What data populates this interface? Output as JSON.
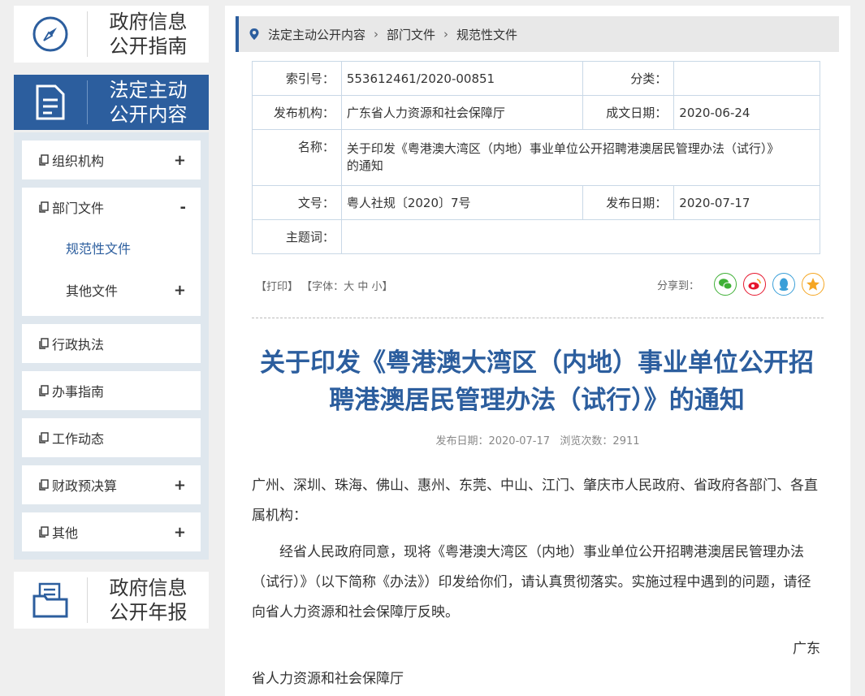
{
  "sidebar": {
    "guide": {
      "line1": "政府信息",
      "line2": "公开指南",
      "icon": "compass-icon"
    },
    "active": {
      "line1": "法定主动",
      "line2": "公开内容",
      "icon": "document-icon"
    },
    "items": [
      {
        "label": "组织机构",
        "toggle": "+"
      },
      {
        "label": "部门文件",
        "toggle": "-"
      },
      {
        "label": "行政执法",
        "toggle": ""
      },
      {
        "label": "办事指南",
        "toggle": ""
      },
      {
        "label": "工作动态",
        "toggle": ""
      },
      {
        "label": "财政预决算",
        "toggle": "+"
      },
      {
        "label": "其他",
        "toggle": "+"
      }
    ],
    "sub_items": [
      {
        "label": "规范性文件",
        "toggle": ""
      },
      {
        "label": "其他文件",
        "toggle": "+"
      }
    ],
    "annual": {
      "line1": "政府信息",
      "line2": "公开年报",
      "icon": "folder-icon"
    }
  },
  "breadcrumb": [
    "法定主动公开内容",
    "部门文件",
    "规范性文件"
  ],
  "meta": {
    "index_label": "索引号：",
    "index_value": "553612461/2020-00851",
    "category_label": "分类：",
    "category_value": "",
    "issuer_label": "发布机构：",
    "issuer_value": "广东省人力资源和社会保障厅",
    "created_label": "成文日期：",
    "created_value": "2020-06-24",
    "name_label": "名称：",
    "name_value": "关于印发《粤港澳大湾区（内地）事业单位公开招聘港澳居民管理办法（试行）》的通知",
    "docno_label": "文号：",
    "docno_value": "粤人社规〔2020〕7号",
    "pubdate_label": "发布日期：",
    "pubdate_value": "2020-07-17",
    "subject_label": "主题词：",
    "subject_value": ""
  },
  "tools": {
    "print": "【打印】",
    "font_prefix": "【字体：",
    "font_large": "大",
    "font_medium": "中",
    "font_small": "小",
    "font_suffix": "】",
    "share_label": "分享到："
  },
  "colors": {
    "accent": "#2c5e9e",
    "wechat": "#3fb036",
    "weibo": "#e6162d",
    "qq": "#3a9fd8",
    "qzone": "#f5a623"
  },
  "article": {
    "title_line1": "关于印发《粤港澳大湾区（内地）事业单位公开招",
    "title_line2": "聘港澳居民管理办法（试行）》的通知",
    "pub_info": "发布日期：2020-07-17   浏览次数：2911",
    "recipients": "广州、深圳、珠海、佛山、惠州、东莞、中山、江门、肇庆市人民政府、省政府各部门、各直属机构：",
    "para1": "经省人民政府同意，现将《粤港澳大湾区（内地）事业单位公开招聘港澳居民管理办法（试行）》（以下简称《办法》）印发给你们，请认真贯彻落实。实施过程中遇到的问题，请径向省人力资源和社会保障厅反映。",
    "sign_right": "广东",
    "sign_left": "省人力资源和社会保障厅"
  }
}
